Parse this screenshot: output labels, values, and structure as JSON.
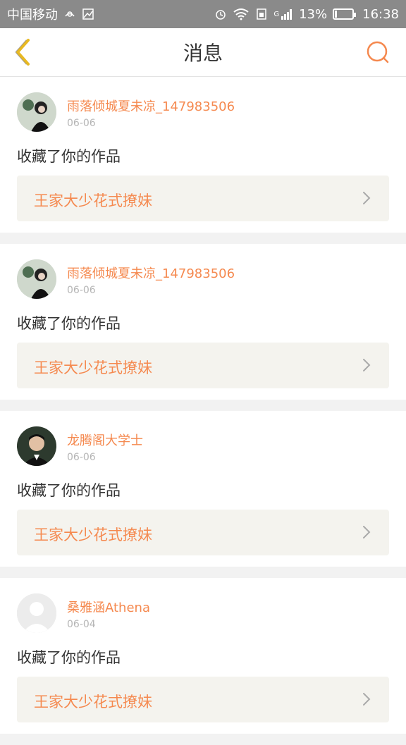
{
  "status_bar": {
    "carrier": "中国移动",
    "network": "G",
    "battery": "13%",
    "battery_level": 0.13,
    "time": "16:38"
  },
  "header": {
    "title": "消息"
  },
  "messages": [
    {
      "user": "雨落倾城夏未凉_147983506",
      "date": "06-06",
      "action": "收藏了你的作品",
      "work": "王家大少花式撩妹"
    },
    {
      "user": "雨落倾城夏未凉_147983506",
      "date": "06-06",
      "action": "收藏了你的作品",
      "work": "王家大少花式撩妹"
    },
    {
      "user": "龙腾阁大学士",
      "date": "06-06",
      "action": "收藏了你的作品",
      "work": "王家大少花式撩妹"
    },
    {
      "user": "桑雅涵Athena",
      "date": "06-04",
      "action": "收藏了你的作品",
      "work": "王家大少花式撩妹"
    }
  ],
  "colors": {
    "accent": "#f5894f",
    "back_arrow": "#e8b923",
    "status_bar_bg": "#8a8a8a",
    "work_box_bg": "#f4f3ee"
  }
}
